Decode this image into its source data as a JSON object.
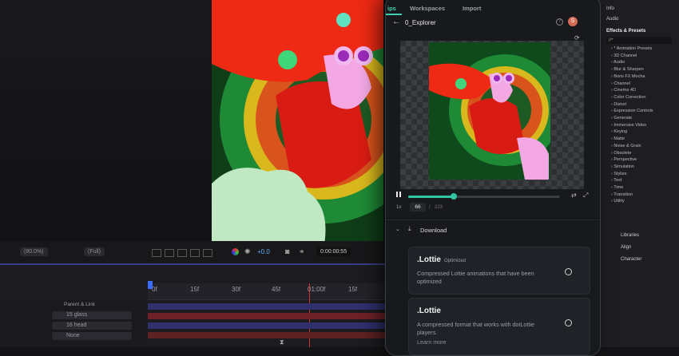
{
  "app": {
    "tabs": [
      {
        "label": "ips",
        "active": true
      },
      {
        "label": "Workspaces",
        "active": false
      },
      {
        "label": "Import",
        "active": false
      }
    ],
    "file_name": "0_Explorer",
    "avatar_initial": "S",
    "player": {
      "speed": "1x",
      "current_frame": "66",
      "separator": "/",
      "total_frames": "223",
      "progress": 0.3
    },
    "download": {
      "label": "Download",
      "options": [
        {
          "title": ".Lottie",
          "badge": "Optimized",
          "description": "Compressed Lottie animations that have been optimized"
        },
        {
          "title": ".Lottie",
          "badge": "",
          "description": "A compressed format that works with dotLottie players.",
          "link": "Learn more"
        }
      ]
    }
  },
  "editor": {
    "zoom_select": "(80.0%)",
    "resolution_select": "(Full)",
    "exposure": "+0.0",
    "timecode": "0:00:00:55",
    "ruler_ticks": [
      "0f",
      "15f",
      "30f",
      "45f",
      "01:00f",
      "15f",
      "30f"
    ],
    "layer_header": "Parent & Link",
    "layer_parents": [
      "15 glass",
      "16 head",
      "None"
    ],
    "accent_color": "#3fd1b0",
    "timeline_colors": [
      "#3a3a8a",
      "#8a2a30",
      "#3a3a8a",
      "#7a2a2a"
    ]
  },
  "right_panel": {
    "info": "Info",
    "audio": "Audio",
    "effects_title": "Effects & Presets",
    "search_placeholder": "ρ•",
    "effects": [
      "* Animation Presets",
      "3D Channel",
      "Audio",
      "Blur & Sharpen",
      "Boris FX Mocha",
      "Channel",
      "Cinema 4D",
      "Color Correction",
      "Distort",
      "Expression Controls",
      "Generate",
      "Immersive Video",
      "Keying",
      "Matte",
      "Noise & Grain",
      "Obsolete",
      "Perspective",
      "Simulation",
      "Stylize",
      "Text",
      "Time",
      "Transition",
      "Utility"
    ],
    "bottom_items": [
      "Libraries",
      "Align",
      "Character"
    ]
  }
}
